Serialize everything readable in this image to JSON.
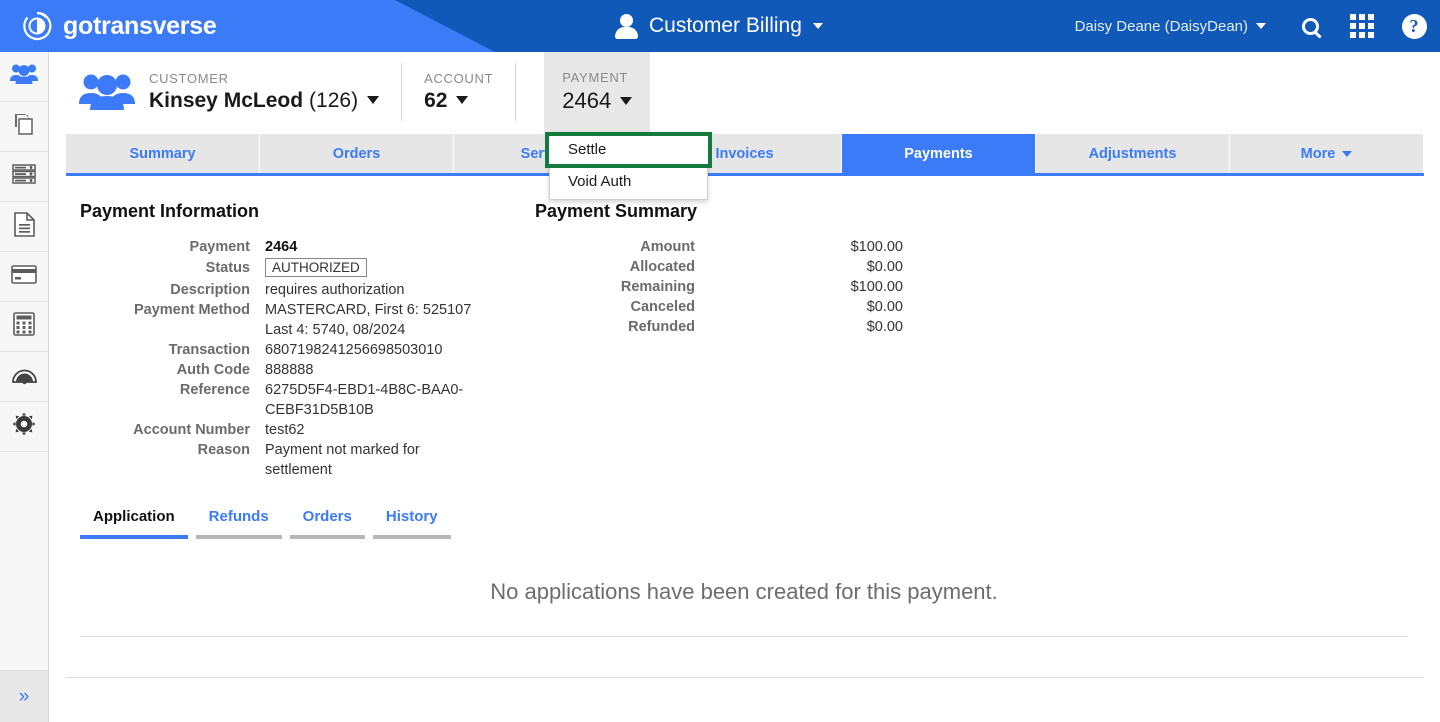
{
  "header": {
    "brand": "gotransverse",
    "brand_icon": "gotransverse-logo-icon",
    "app_title": "Customer Billing",
    "app_title_icon": "person-icon",
    "user": "Daisy Deane (DaisyDean)",
    "search_icon": "search-icon",
    "apps_icon": "apps-grid-icon",
    "help_icon": "help-circle-icon",
    "colors": {
      "light_blue": "#3b7bf7",
      "dark_blue": "#1059b8"
    }
  },
  "sidebar": {
    "items": [
      {
        "icon": "customers-icon",
        "active": true
      },
      {
        "icon": "copy-documents-icon",
        "active": false
      },
      {
        "icon": "server-list-icon",
        "active": false
      },
      {
        "icon": "document-icon",
        "active": false
      },
      {
        "icon": "credit-card-icon",
        "active": false
      },
      {
        "icon": "calculator-icon",
        "active": false
      },
      {
        "icon": "dashboard-gauge-icon",
        "active": false
      },
      {
        "icon": "gear-settings-icon",
        "active": false
      }
    ],
    "expand_icon": "double-chevron-right-icon",
    "expand_label": "»"
  },
  "breadcrumb": {
    "customer": {
      "label": "CUSTOMER",
      "name": "Kinsey McLeod",
      "id": "(126)",
      "icon": "people-group-icon"
    },
    "account": {
      "label": "ACCOUNT",
      "value": "62"
    },
    "payment": {
      "label": "PAYMENT",
      "value": "2464"
    }
  },
  "payment_menu": {
    "items": [
      {
        "label": "Settle",
        "highlighted": true
      },
      {
        "label": "Void Auth",
        "highlighted": false
      }
    ],
    "highlight_color": "#147a3d"
  },
  "tabs": [
    {
      "label": "Summary",
      "active": false
    },
    {
      "label": "Orders",
      "active": false
    },
    {
      "label": "Services",
      "active": false
    },
    {
      "label": "Invoices",
      "active": false
    },
    {
      "label": "Payments",
      "active": true
    },
    {
      "label": "Adjustments",
      "active": false
    },
    {
      "label": "More",
      "active": false,
      "has_caret": true
    }
  ],
  "payment_information": {
    "title": "Payment Information",
    "rows": [
      {
        "label": "Payment",
        "value": "2464",
        "bold": true
      },
      {
        "label": "Status",
        "value": "AUTHORIZED",
        "badge": true
      },
      {
        "label": "Description",
        "value": "requires authorization"
      },
      {
        "label": "Payment Method",
        "value": "MASTERCARD, First 6: 525107",
        "value2": "Last 4: 5740, 08/2024"
      },
      {
        "label": "Transaction",
        "value": "6807198241256698503010"
      },
      {
        "label": "Auth Code",
        "value": "888888"
      },
      {
        "label": "Reference",
        "value": "6275D5F4-EBD1-4B8C-BAA0-",
        "value2": "CEBF31D5B10B"
      },
      {
        "label": "Account Number",
        "value": "test62"
      },
      {
        "label": "Reason",
        "value": "Payment not marked for",
        "value2": "settlement"
      }
    ]
  },
  "payment_summary": {
    "title": "Payment Summary",
    "rows": [
      {
        "label": "Amount",
        "value": "$100.00"
      },
      {
        "label": "Allocated",
        "value": "$0.00"
      },
      {
        "label": "Remaining",
        "value": "$100.00"
      },
      {
        "label": "Canceled",
        "value": "$0.00"
      },
      {
        "label": "Refunded",
        "value": "$0.00"
      }
    ]
  },
  "inner_tabs": [
    {
      "label": "Application",
      "active": true
    },
    {
      "label": "Refunds",
      "active": false
    },
    {
      "label": "Orders",
      "active": false
    },
    {
      "label": "History",
      "active": false
    }
  ],
  "empty_state": {
    "message": "No applications have been created for this payment."
  }
}
